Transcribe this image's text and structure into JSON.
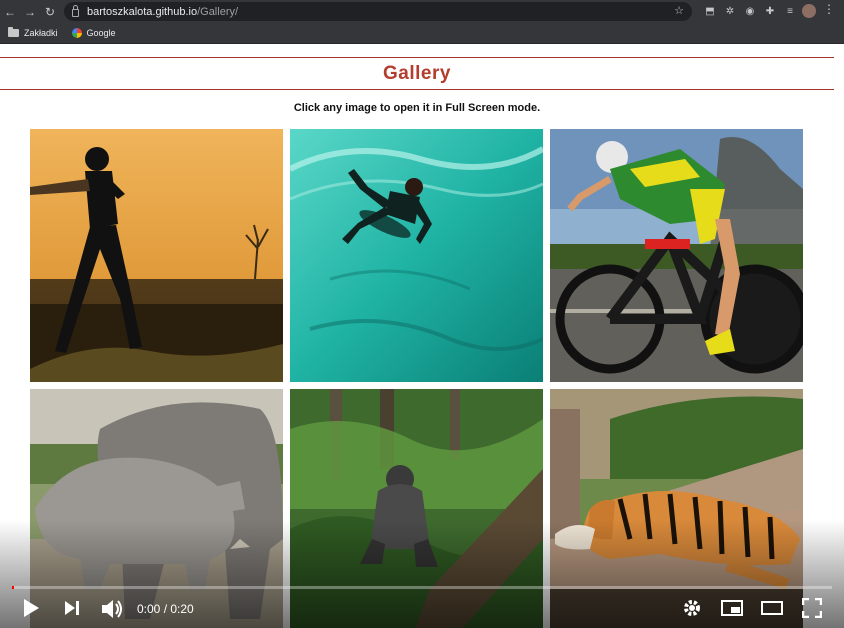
{
  "browser": {
    "url_host": "bartoszkalota.github.io",
    "url_path": "/Gallery/",
    "bookmarks": [
      {
        "label": "Zakładki",
        "icon": "folder-icon"
      },
      {
        "label": "Google",
        "icon": "google-icon"
      }
    ]
  },
  "page": {
    "title": "Gallery",
    "subtitle": "Click any image to open it in Full Screen mode.",
    "accent_color": "#b43d2e",
    "images": [
      {
        "subject": "cricket-batsman-silhouette"
      },
      {
        "subject": "surfer-in-wave"
      },
      {
        "subject": "time-trial-cyclist"
      },
      {
        "subject": "rhinoceroses"
      },
      {
        "subject": "gorilla-in-forest"
      },
      {
        "subject": "tiger-resting"
      }
    ]
  },
  "video": {
    "time": "0:00 / 0:20",
    "progress_fraction": 0.003
  }
}
